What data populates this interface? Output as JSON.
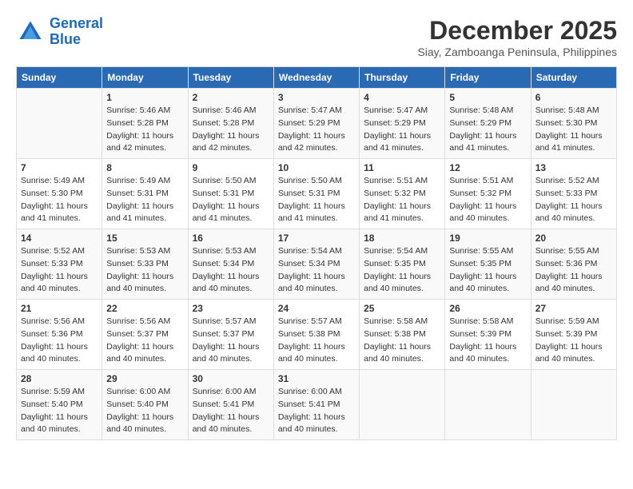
{
  "logo": {
    "line1": "General",
    "line2": "Blue"
  },
  "title": "December 2025",
  "subtitle": "Siay, Zamboanga Peninsula, Philippines",
  "headers": [
    "Sunday",
    "Monday",
    "Tuesday",
    "Wednesday",
    "Thursday",
    "Friday",
    "Saturday"
  ],
  "weeks": [
    [
      {
        "day": "",
        "sunrise": "",
        "sunset": "",
        "daylight": ""
      },
      {
        "day": "1",
        "sunrise": "Sunrise: 5:46 AM",
        "sunset": "Sunset: 5:28 PM",
        "daylight": "Daylight: 11 hours and 42 minutes."
      },
      {
        "day": "2",
        "sunrise": "Sunrise: 5:46 AM",
        "sunset": "Sunset: 5:28 PM",
        "daylight": "Daylight: 11 hours and 42 minutes."
      },
      {
        "day": "3",
        "sunrise": "Sunrise: 5:47 AM",
        "sunset": "Sunset: 5:29 PM",
        "daylight": "Daylight: 11 hours and 42 minutes."
      },
      {
        "day": "4",
        "sunrise": "Sunrise: 5:47 AM",
        "sunset": "Sunset: 5:29 PM",
        "daylight": "Daylight: 11 hours and 41 minutes."
      },
      {
        "day": "5",
        "sunrise": "Sunrise: 5:48 AM",
        "sunset": "Sunset: 5:29 PM",
        "daylight": "Daylight: 11 hours and 41 minutes."
      },
      {
        "day": "6",
        "sunrise": "Sunrise: 5:48 AM",
        "sunset": "Sunset: 5:30 PM",
        "daylight": "Daylight: 11 hours and 41 minutes."
      }
    ],
    [
      {
        "day": "7",
        "sunrise": "Sunrise: 5:49 AM",
        "sunset": "Sunset: 5:30 PM",
        "daylight": "Daylight: 11 hours and 41 minutes."
      },
      {
        "day": "8",
        "sunrise": "Sunrise: 5:49 AM",
        "sunset": "Sunset: 5:31 PM",
        "daylight": "Daylight: 11 hours and 41 minutes."
      },
      {
        "day": "9",
        "sunrise": "Sunrise: 5:50 AM",
        "sunset": "Sunset: 5:31 PM",
        "daylight": "Daylight: 11 hours and 41 minutes."
      },
      {
        "day": "10",
        "sunrise": "Sunrise: 5:50 AM",
        "sunset": "Sunset: 5:31 PM",
        "daylight": "Daylight: 11 hours and 41 minutes."
      },
      {
        "day": "11",
        "sunrise": "Sunrise: 5:51 AM",
        "sunset": "Sunset: 5:32 PM",
        "daylight": "Daylight: 11 hours and 41 minutes."
      },
      {
        "day": "12",
        "sunrise": "Sunrise: 5:51 AM",
        "sunset": "Sunset: 5:32 PM",
        "daylight": "Daylight: 11 hours and 40 minutes."
      },
      {
        "day": "13",
        "sunrise": "Sunrise: 5:52 AM",
        "sunset": "Sunset: 5:33 PM",
        "daylight": "Daylight: 11 hours and 40 minutes."
      }
    ],
    [
      {
        "day": "14",
        "sunrise": "Sunrise: 5:52 AM",
        "sunset": "Sunset: 5:33 PM",
        "daylight": "Daylight: 11 hours and 40 minutes."
      },
      {
        "day": "15",
        "sunrise": "Sunrise: 5:53 AM",
        "sunset": "Sunset: 5:33 PM",
        "daylight": "Daylight: 11 hours and 40 minutes."
      },
      {
        "day": "16",
        "sunrise": "Sunrise: 5:53 AM",
        "sunset": "Sunset: 5:34 PM",
        "daylight": "Daylight: 11 hours and 40 minutes."
      },
      {
        "day": "17",
        "sunrise": "Sunrise: 5:54 AM",
        "sunset": "Sunset: 5:34 PM",
        "daylight": "Daylight: 11 hours and 40 minutes."
      },
      {
        "day": "18",
        "sunrise": "Sunrise: 5:54 AM",
        "sunset": "Sunset: 5:35 PM",
        "daylight": "Daylight: 11 hours and 40 minutes."
      },
      {
        "day": "19",
        "sunrise": "Sunrise: 5:55 AM",
        "sunset": "Sunset: 5:35 PM",
        "daylight": "Daylight: 11 hours and 40 minutes."
      },
      {
        "day": "20",
        "sunrise": "Sunrise: 5:55 AM",
        "sunset": "Sunset: 5:36 PM",
        "daylight": "Daylight: 11 hours and 40 minutes."
      }
    ],
    [
      {
        "day": "21",
        "sunrise": "Sunrise: 5:56 AM",
        "sunset": "Sunset: 5:36 PM",
        "daylight": "Daylight: 11 hours and 40 minutes."
      },
      {
        "day": "22",
        "sunrise": "Sunrise: 5:56 AM",
        "sunset": "Sunset: 5:37 PM",
        "daylight": "Daylight: 11 hours and 40 minutes."
      },
      {
        "day": "23",
        "sunrise": "Sunrise: 5:57 AM",
        "sunset": "Sunset: 5:37 PM",
        "daylight": "Daylight: 11 hours and 40 minutes."
      },
      {
        "day": "24",
        "sunrise": "Sunrise: 5:57 AM",
        "sunset": "Sunset: 5:38 PM",
        "daylight": "Daylight: 11 hours and 40 minutes."
      },
      {
        "day": "25",
        "sunrise": "Sunrise: 5:58 AM",
        "sunset": "Sunset: 5:38 PM",
        "daylight": "Daylight: 11 hours and 40 minutes."
      },
      {
        "day": "26",
        "sunrise": "Sunrise: 5:58 AM",
        "sunset": "Sunset: 5:39 PM",
        "daylight": "Daylight: 11 hours and 40 minutes."
      },
      {
        "day": "27",
        "sunrise": "Sunrise: 5:59 AM",
        "sunset": "Sunset: 5:39 PM",
        "daylight": "Daylight: 11 hours and 40 minutes."
      }
    ],
    [
      {
        "day": "28",
        "sunrise": "Sunrise: 5:59 AM",
        "sunset": "Sunset: 5:40 PM",
        "daylight": "Daylight: 11 hours and 40 minutes."
      },
      {
        "day": "29",
        "sunrise": "Sunrise: 6:00 AM",
        "sunset": "Sunset: 5:40 PM",
        "daylight": "Daylight: 11 hours and 40 minutes."
      },
      {
        "day": "30",
        "sunrise": "Sunrise: 6:00 AM",
        "sunset": "Sunset: 5:41 PM",
        "daylight": "Daylight: 11 hours and 40 minutes."
      },
      {
        "day": "31",
        "sunrise": "Sunrise: 6:00 AM",
        "sunset": "Sunset: 5:41 PM",
        "daylight": "Daylight: 11 hours and 40 minutes."
      },
      {
        "day": "",
        "sunrise": "",
        "sunset": "",
        "daylight": ""
      },
      {
        "day": "",
        "sunrise": "",
        "sunset": "",
        "daylight": ""
      },
      {
        "day": "",
        "sunrise": "",
        "sunset": "",
        "daylight": ""
      }
    ]
  ]
}
